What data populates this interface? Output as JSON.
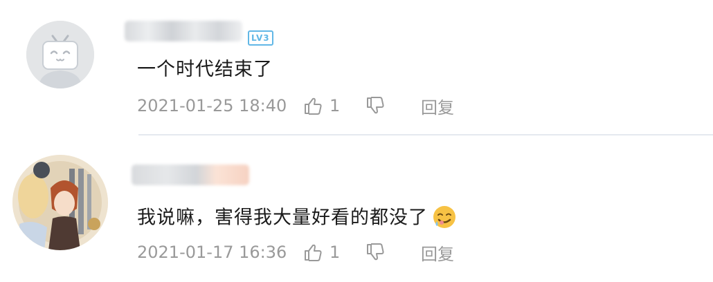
{
  "comments": [
    {
      "level_badge": "LV3",
      "content": "一个时代结束了",
      "timestamp": "2021-01-25 18:40",
      "like_count": "1",
      "reply_label": "回复"
    },
    {
      "content": "我说嘛，害得我大量好看的都没了",
      "timestamp": "2021-01-17 16:36",
      "like_count": "1",
      "reply_label": "回复"
    }
  ],
  "colors": {
    "meta_gray": "#999999",
    "badge_blue": "#61b7e6",
    "divider": "#e5e9ef"
  },
  "icons": [
    "tv-mascot-avatar-icon",
    "thumbs-up-icon",
    "thumbs-down-icon",
    "sweat-smile-emoji-icon"
  ]
}
